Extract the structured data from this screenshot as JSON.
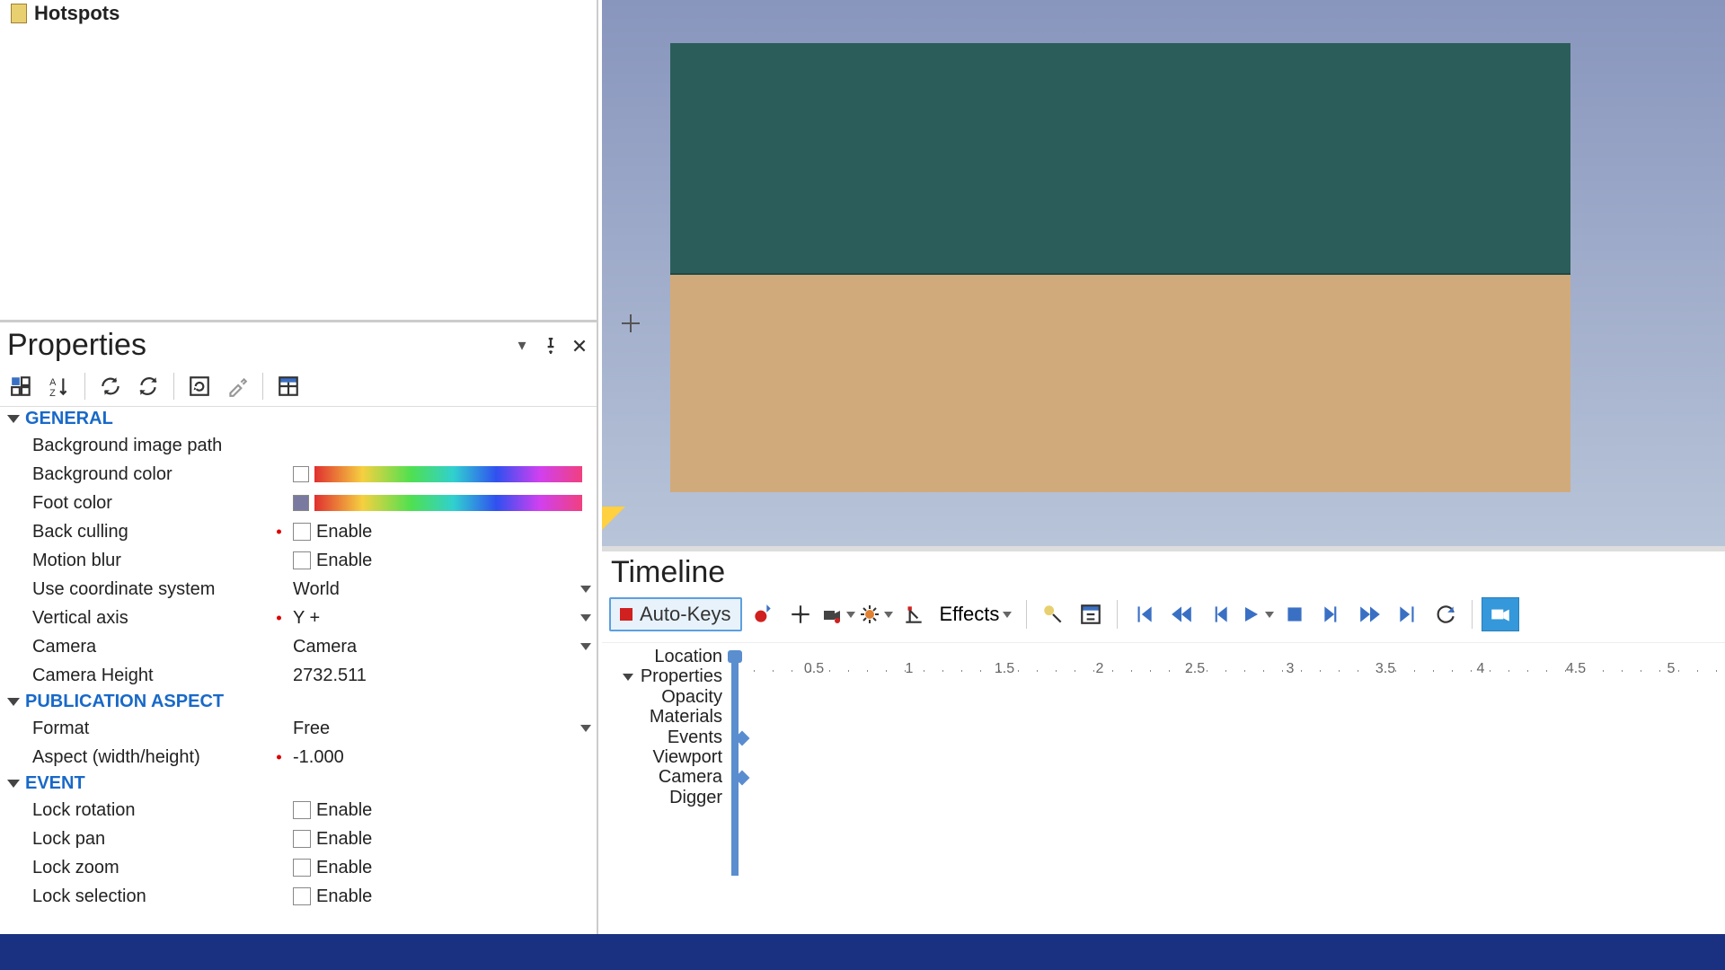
{
  "top": {
    "hotspots_label": "Hotspots"
  },
  "properties": {
    "title": "Properties",
    "sections": {
      "general": {
        "header": "GENERAL",
        "bg_image_path": {
          "label": "Background image path",
          "value": ""
        },
        "bg_color": {
          "label": "Background color",
          "swatch": "#ffffff"
        },
        "foot_color": {
          "label": "Foot color",
          "swatch": "#7a7aa0"
        },
        "back_culling": {
          "label": "Back culling",
          "checkbox_label": "Enable",
          "checked": false
        },
        "motion_blur": {
          "label": "Motion blur",
          "checkbox_label": "Enable",
          "checked": false
        },
        "coord_system": {
          "label": "Use coordinate system",
          "value": "World"
        },
        "vertical_axis": {
          "label": "Vertical axis",
          "value": "Y +"
        },
        "camera": {
          "label": "Camera",
          "value": "Camera"
        },
        "camera_height": {
          "label": "Camera Height",
          "value": "2732.511"
        }
      },
      "publication": {
        "header": "PUBLICATION ASPECT",
        "format": {
          "label": "Format",
          "value": "Free"
        },
        "aspect": {
          "label": "Aspect (width/height)",
          "value": "-1.000"
        }
      },
      "event": {
        "header": "EVENT",
        "lock_rotation": {
          "label": "Lock rotation",
          "checkbox_label": "Enable",
          "checked": false
        },
        "lock_pan": {
          "label": "Lock pan",
          "checkbox_label": "Enable",
          "checked": false
        },
        "lock_zoom": {
          "label": "Lock zoom",
          "checkbox_label": "Enable",
          "checked": false
        },
        "lock_selection": {
          "label": "Lock selection",
          "checkbox_label": "Enable",
          "checked": false
        }
      }
    }
  },
  "timeline": {
    "title": "Timeline",
    "autokeys_label": "Auto-Keys",
    "effects_label": "Effects",
    "ruler_ticks": [
      "0.5",
      "1",
      "1.5",
      "2",
      "2.5",
      "3",
      "3.5",
      "4",
      "4.5",
      "5"
    ],
    "tracks": [
      "Location",
      "Properties",
      "Opacity",
      "Materials",
      "Events",
      "Viewport",
      "Camera",
      "Digger"
    ]
  }
}
